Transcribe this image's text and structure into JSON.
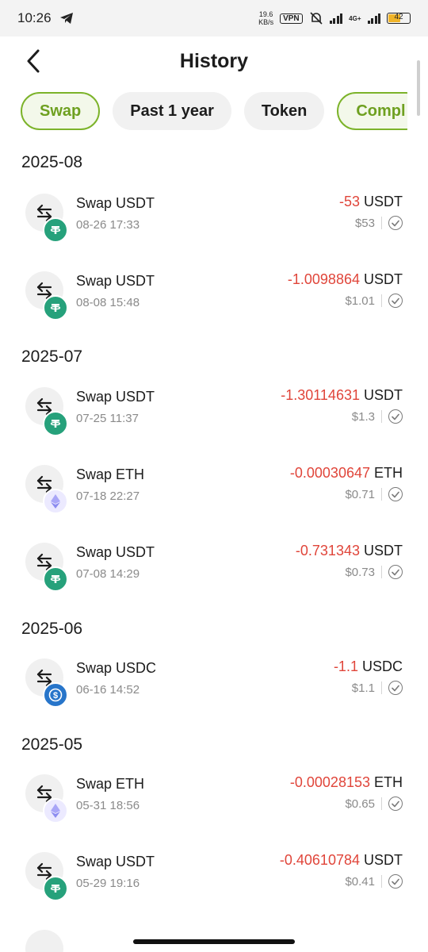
{
  "status": {
    "time": "10:26",
    "net_speed_value": "19.6",
    "net_speed_unit": "KB/s",
    "vpn": "VPN",
    "network": "4G+",
    "battery": "42"
  },
  "header": {
    "title": "History"
  },
  "filters": [
    {
      "label": "Swap",
      "active": true
    },
    {
      "label": "Past 1 year",
      "active": false
    },
    {
      "label": "Token",
      "active": false
    },
    {
      "label": "Compl",
      "active": true
    }
  ],
  "sections": [
    {
      "title": "2025-08"
    },
    {
      "title": "2025-07"
    },
    {
      "title": "2025-06"
    },
    {
      "title": "2025-05"
    }
  ],
  "transactions": [
    {
      "name": "Swap USDT",
      "time": "08-26 17:33",
      "amount": "-53",
      "symbol": "USDT",
      "usd": "$53",
      "token_icon": "tether-icon"
    },
    {
      "name": "Swap USDT",
      "time": "08-08 15:48",
      "amount": "-1.0098864",
      "symbol": "USDT",
      "usd": "$1.01",
      "token_icon": "tether-icon"
    },
    {
      "name": "Swap USDT",
      "time": "07-25 11:37",
      "amount": "-1.30114631",
      "symbol": "USDT",
      "usd": "$1.3",
      "token_icon": "tether-icon"
    },
    {
      "name": "Swap ETH",
      "time": "07-18 22:27",
      "amount": "-0.00030647",
      "symbol": "ETH",
      "usd": "$0.71",
      "token_icon": "ethereum-icon"
    },
    {
      "name": "Swap USDT",
      "time": "07-08 14:29",
      "amount": "-0.731343",
      "symbol": "USDT",
      "usd": "$0.73",
      "token_icon": "tether-icon"
    },
    {
      "name": "Swap USDC",
      "time": "06-16 14:52",
      "amount": "-1.1",
      "symbol": "USDC",
      "usd": "$1.1",
      "token_icon": "usdc-icon"
    },
    {
      "name": "Swap ETH",
      "time": "05-31 18:56",
      "amount": "-0.00028153",
      "symbol": "ETH",
      "usd": "$0.65",
      "token_icon": "ethereum-icon"
    },
    {
      "name": "Swap USDT",
      "time": "05-29 19:16",
      "amount": "-0.40610784",
      "symbol": "USDT",
      "usd": "$0.41",
      "token_icon": "tether-icon"
    }
  ],
  "colors": {
    "accent_green": "#7cb32a",
    "negative_red": "#e0453a",
    "tether_green": "#26a17b",
    "usdc_blue": "#2775ca",
    "eth_purple": "#8c8cf0"
  }
}
